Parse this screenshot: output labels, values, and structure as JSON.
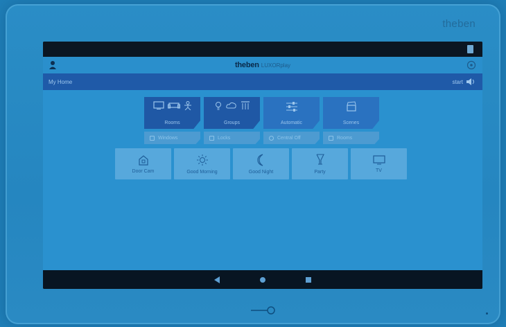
{
  "device": {
    "brand": "theben"
  },
  "app": {
    "logo": "theben",
    "logo_sub": "LUXORplay"
  },
  "nav": {
    "title": "My Home",
    "right_label": "start"
  },
  "tiles": [
    {
      "label": "Rooms",
      "icons": [
        "tv-icon",
        "sofa-icon",
        "person-icon"
      ],
      "style": "dark"
    },
    {
      "label": "Groups",
      "icons": [
        "bulb-icon",
        "cloud-icon",
        "blinds-icon"
      ],
      "style": "dark"
    },
    {
      "label": "Automatic",
      "icons": [
        "sliders-icon"
      ],
      "style": "light"
    },
    {
      "label": "Scenes",
      "icons": [
        "scene-icon"
      ],
      "style": "light"
    }
  ],
  "subtabs": [
    {
      "label": "Windows",
      "icon": "window-icon"
    },
    {
      "label": "Locks",
      "icon": "lock-icon"
    },
    {
      "label": "Central Off",
      "icon": "power-icon"
    },
    {
      "label": "Rooms",
      "icon": "room-icon"
    }
  ],
  "scenes": [
    {
      "label": "Door Cam",
      "icon": "door-cam-icon"
    },
    {
      "label": "Good Morning",
      "icon": "sun-icon"
    },
    {
      "label": "Good Night",
      "icon": "moon-icon"
    },
    {
      "label": "Party",
      "icon": "glass-icon"
    },
    {
      "label": "TV",
      "icon": "tv-icon"
    }
  ],
  "colors": {
    "accent": "#2a91cf",
    "nav": "#1f5aa8",
    "tile_dark": "#1f58a5",
    "tile_light": "#2a72c0"
  }
}
